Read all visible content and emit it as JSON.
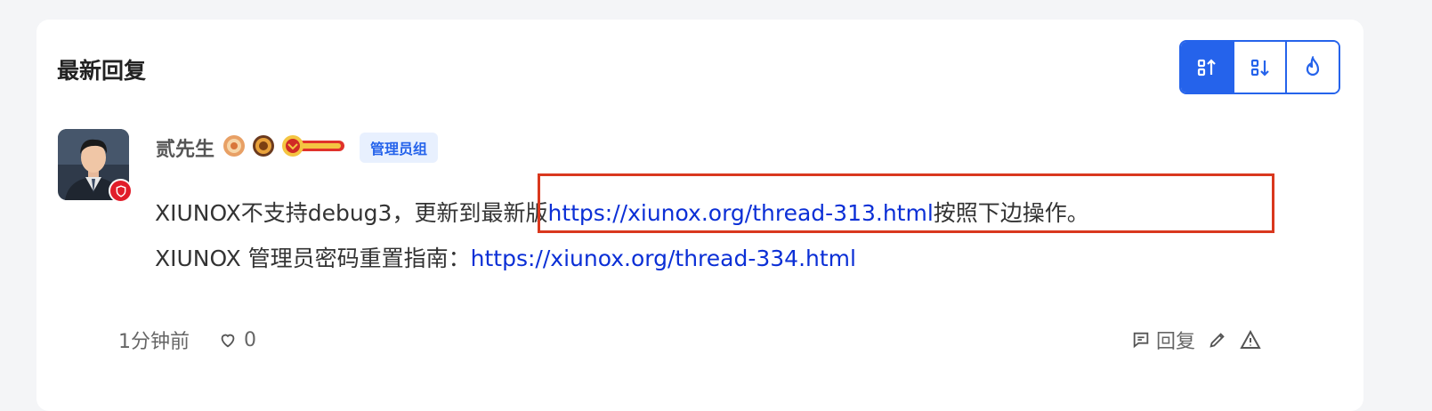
{
  "section": {
    "title": "最新回复"
  },
  "sort_buttons": [
    {
      "icon": "sort-ascending-icon",
      "active": true
    },
    {
      "icon": "sort-descending-icon",
      "active": false
    },
    {
      "icon": "flame-icon",
      "active": false
    }
  ],
  "post": {
    "author": "贰先生",
    "group": "管理员组",
    "line1_prefix": "XIUNOX不支持debug3，",
    "line1_highlight_text": "更新到最新版",
    "line1_link": "https://xiunox.org/thread-313.html",
    "line1_suffix": "按照下边操作。",
    "line2_prefix": "XIUNOX 管理员密码重置指南：",
    "line2_link": "https://xiunox.org/thread-334.html",
    "time": "1分钟前",
    "likes": "0",
    "reply_label": "回复"
  },
  "colors": {
    "accent": "#2563eb",
    "highlight": "#d9381e",
    "link": "#0b2fd6"
  }
}
